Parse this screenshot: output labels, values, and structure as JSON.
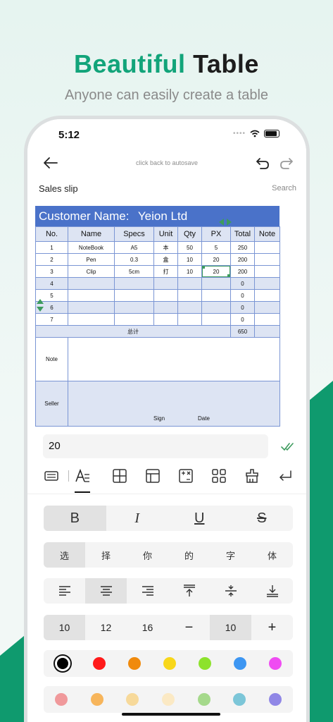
{
  "promo": {
    "headline_accent": "Beautiful",
    "headline_main": "Table",
    "subheadline": "Anyone can easily create a table",
    "accent_color": "#12a47a"
  },
  "status_bar": {
    "time": "5:12",
    "icons": [
      "signal-dots-icon",
      "wifi-icon",
      "battery-icon"
    ]
  },
  "top_bar": {
    "hint": "click back to autosave",
    "icons": [
      "back-arrow-icon",
      "undo-icon",
      "redo-icon"
    ]
  },
  "document": {
    "title": "Sales slip",
    "search_label": "Search"
  },
  "sheet": {
    "header_label": "Customer Name:",
    "header_value": "Yeion Ltd",
    "header_color": "#4a72c9",
    "columns": [
      "No.",
      "Name",
      "Specs",
      "Unit",
      "Qty",
      "PX",
      "Total",
      "Note"
    ],
    "rows": [
      [
        "1",
        "NoteBook",
        "A5",
        "本",
        "50",
        "5",
        "250",
        ""
      ],
      [
        "2",
        "Pen",
        "0.3",
        "盒",
        "10",
        "20",
        "200",
        ""
      ],
      [
        "3",
        "Clip",
        "5cm",
        "打",
        "10",
        "20",
        "200",
        ""
      ],
      [
        "4",
        "",
        "",
        "",
        "",
        "",
        "0",
        ""
      ],
      [
        "5",
        "",
        "",
        "",
        "",
        "",
        "0",
        ""
      ],
      [
        "6",
        "",
        "",
        "",
        "",
        "",
        "0",
        ""
      ],
      [
        "7",
        "",
        "",
        "",
        "",
        "",
        "0",
        ""
      ]
    ],
    "total_label": "总计",
    "total_value": "650",
    "note_label": "Note",
    "seller_label": "Seller",
    "sign_label": "Sign",
    "date_label": "Date",
    "selected_cell_value": "20"
  },
  "editor": {
    "value": "20",
    "tabs": [
      "keyboard-icon",
      "text-format-icon",
      "borders-icon",
      "layout-icon",
      "formula-icon",
      "grid-icon",
      "clear-format-icon",
      "return-icon"
    ],
    "active_tab": "text-format-icon"
  },
  "format_row": {
    "items": [
      "B",
      "I",
      "U",
      "S"
    ],
    "active": "B"
  },
  "font_row": {
    "items": [
      "选",
      "择",
      "你",
      "的",
      "字",
      "体"
    ],
    "active": "选"
  },
  "align_row": {
    "items": [
      "align-left-icon",
      "align-center-icon",
      "align-right-icon",
      "align-top-icon",
      "align-middle-icon",
      "align-bottom-icon"
    ],
    "active": "align-center-icon"
  },
  "size_row": {
    "items": [
      "10",
      "12",
      "16",
      "−",
      "10",
      "+"
    ],
    "active": [
      "10",
      "10"
    ]
  },
  "colors_row_1": [
    "#000000",
    "#ff1a1a",
    "#f08a0c",
    "#f8d71a",
    "#8de22c",
    "#3d96f2",
    "#ef4cf2"
  ],
  "colors_row_1_selected": "#000000",
  "colors_row_2": [
    "#f0999b",
    "#f7b55b",
    "#f7d99a",
    "#fbe9c4",
    "#a5d98b",
    "#7cc6d8",
    "#9087e6"
  ]
}
